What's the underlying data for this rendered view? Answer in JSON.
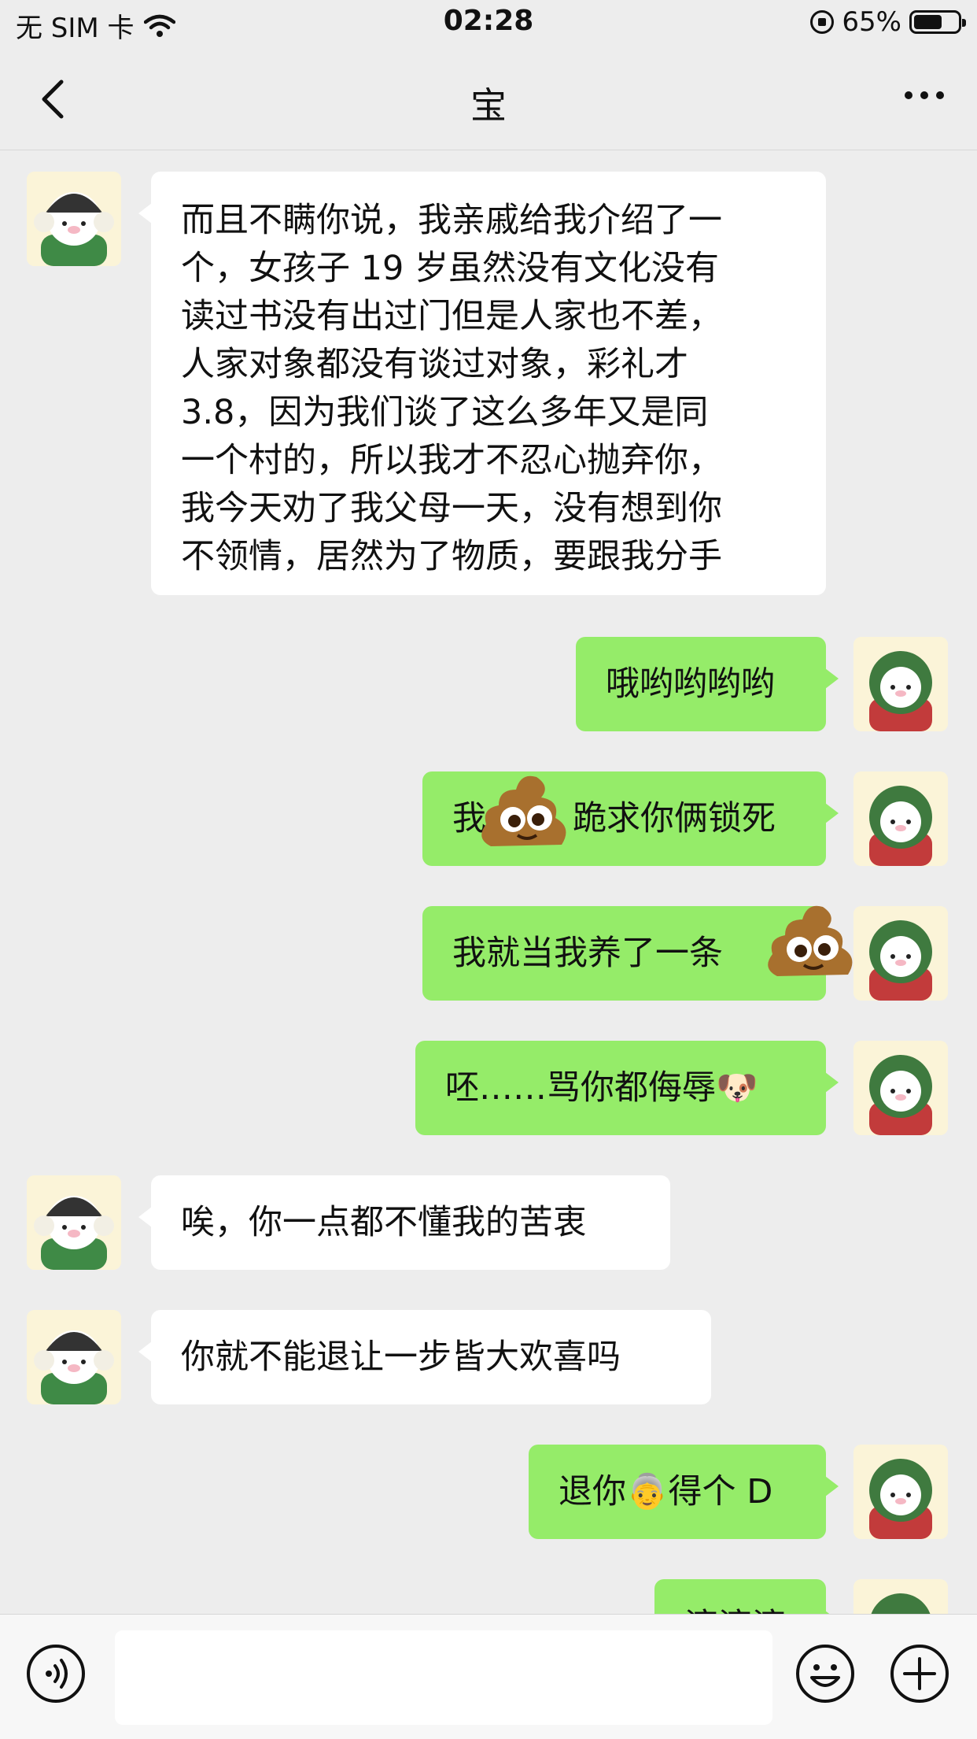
{
  "status_bar": {
    "carrier": "无 SIM 卡",
    "time": "02:28",
    "battery_percent": "65%",
    "battery_level": 0.65
  },
  "nav": {
    "title": "宝",
    "back_icon": "chevron-left-icon",
    "more_icon": "more-dots-icon"
  },
  "messages": [
    {
      "side": "in",
      "text": "而且不瞒你说，我亲戚给我介绍了一\n个，女孩子 19 岁虽然没有文化没有\n读过书没有出过门但是人家也不差，\n人家对象都没有谈过对象，彩礼才\n3.8，因为我们谈了这么多年又是同\n一个村的，所以我才不忍心抛弃你，\n我今天劝了我父母一天，没有想到你\n不领情，居然为了物质，要跟我分手"
    },
    {
      "side": "out",
      "text": "哦哟哟哟哟"
    },
    {
      "side": "out",
      "text": "我",
      "text2": "跪求你俩锁死",
      "sticker": "poop-emoji"
    },
    {
      "side": "out",
      "text": "我就当我养了一条",
      "sticker": "poop-emoji"
    },
    {
      "side": "out",
      "text": "呸……骂你都侮辱",
      "emoji": "🐶"
    },
    {
      "side": "in",
      "text": "唉，你一点都不懂我的苦衷"
    },
    {
      "side": "in",
      "text": "你就不能退让一步皆大欢喜吗"
    },
    {
      "side": "out",
      "text": "退你",
      "emoji": "👵",
      "text2": "得个 D"
    },
    {
      "side": "out",
      "text": "滚滚滚"
    }
  ],
  "input": {
    "placeholder": ""
  },
  "colors": {
    "incoming": "#ffffff",
    "outgoing": "#95ec69",
    "background": "#ededed"
  }
}
